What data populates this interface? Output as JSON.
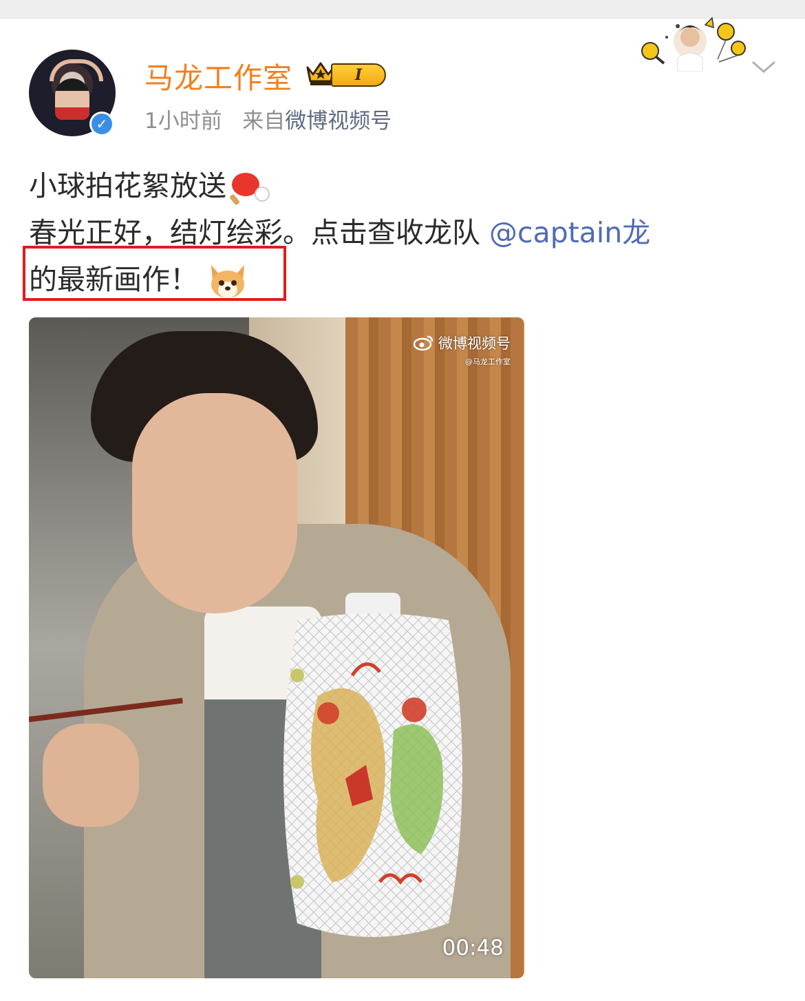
{
  "post": {
    "author": "马龙工作室",
    "member_level": "I",
    "time": "1小时前",
    "source_prefix": "来自",
    "source": "微博视频号",
    "text_line1": "小球拍花絮放送",
    "text_line2_plain": "春光正好，结灯绘彩。点击查收龙队 ",
    "mention": "@captain龙",
    "text_line3": "的最新画作！",
    "emoji_line1": "ping-pong-paddle-icon",
    "emoji_line3": "dog-face-icon"
  },
  "video": {
    "watermark_title": "微博视频号",
    "watermark_sub": "@马龙工作室",
    "duration": "00:48"
  },
  "colors": {
    "author": "#f0801f",
    "mention": "#4f6bb4",
    "highlight": "#e11b1b",
    "meta": "#8f8f8f"
  }
}
